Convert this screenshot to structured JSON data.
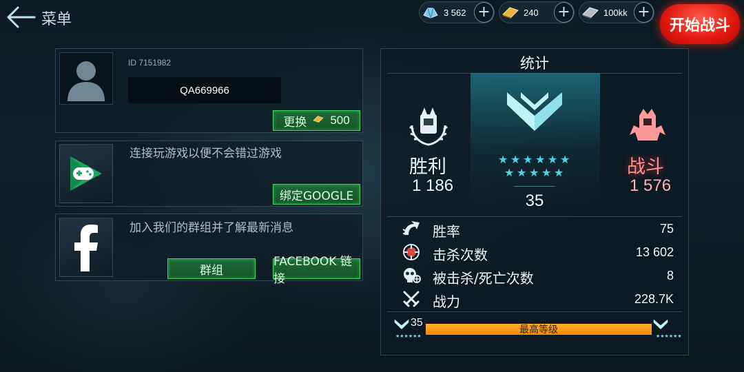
{
  "header": {
    "menu_label": "菜单",
    "start_battle": "开始战斗",
    "resources": [
      {
        "name": "crystals",
        "value": "3 562"
      },
      {
        "name": "gold",
        "value": "240"
      },
      {
        "name": "silver",
        "value": "100kk"
      }
    ]
  },
  "profile": {
    "id_label": "ID 7151982",
    "player_name": "QA669966",
    "change_label": "更换",
    "change_cost": "500"
  },
  "google": {
    "text": "连接玩游戏以便不会错过游戏",
    "button": "绑定GOOGLE"
  },
  "facebook": {
    "text": "加入我们的群组并了解最新消息",
    "group_button": "群组",
    "link_button": "FACEBOOK 链接"
  },
  "stats": {
    "title": "统计",
    "wins_label": "胜利",
    "wins_value": "1 186",
    "battles_label": "战斗",
    "battles_value": "1 576",
    "rank_level": "35",
    "rank_stars": 11,
    "rows": [
      {
        "icon": "winrate-icon",
        "label": "胜率",
        "value": "75"
      },
      {
        "icon": "target-icon",
        "label": "击杀次数",
        "value": "13 602"
      },
      {
        "icon": "skull-icon",
        "label": "被击杀/死亡次数",
        "value": "8"
      },
      {
        "icon": "swords-icon",
        "label": "战力",
        "value": "228.7K"
      }
    ],
    "level_current": "35",
    "level_progress_text": "最高等级",
    "level_progress": 1.0
  },
  "colors": {
    "accent_green": "#3ed26a",
    "start_red": "#e0170f",
    "progress_orange": "#f59a10",
    "cyan": "#4fd4e6",
    "battle_pink": "#ff9a9a"
  }
}
